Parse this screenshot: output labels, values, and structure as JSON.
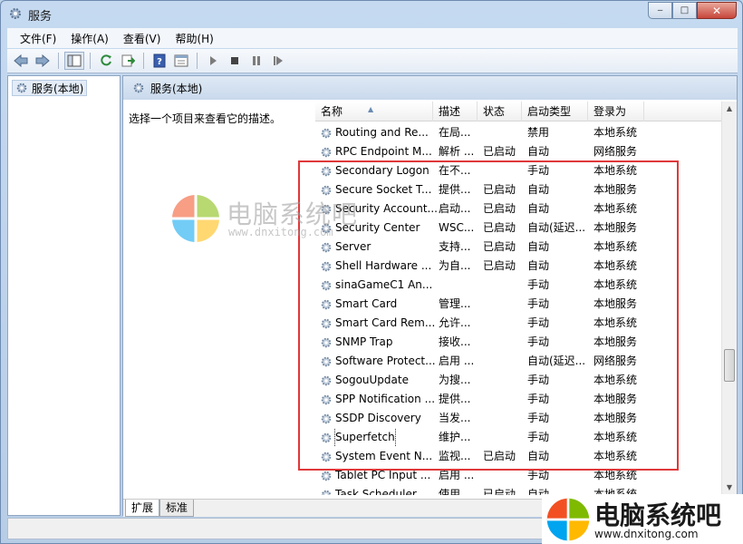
{
  "window": {
    "title": "服务",
    "controls": {
      "minimize": "‒",
      "maximize": "□",
      "close": "✕"
    }
  },
  "menu": [
    "文件(F)",
    "操作(A)",
    "查看(V)",
    "帮助(H)"
  ],
  "toolbar": {
    "icons": [
      "back-icon",
      "forward-icon",
      "show-hide-tree-icon",
      "refresh-icon",
      "export-list-icon",
      "help-icon",
      "properties-icon",
      "start-service-icon",
      "stop-service-icon",
      "pause-service-icon",
      "restart-service-icon"
    ]
  },
  "tree": {
    "item": "服务(本地)"
  },
  "pane": {
    "header": "服务(本地)",
    "description": "选择一个项目来查看它的描述。"
  },
  "columns": {
    "name": "名称",
    "desc": "描述",
    "state": "状态",
    "startup": "启动类型",
    "logon": "登录为"
  },
  "rows": [
    {
      "name": "Routing and Re...",
      "desc": "在局...",
      "state": "",
      "startup": "禁用",
      "logon": "本地系统"
    },
    {
      "name": "RPC Endpoint M...",
      "desc": "解析 ...",
      "state": "已启动",
      "startup": "自动",
      "logon": "网络服务"
    },
    {
      "name": "Secondary Logon",
      "desc": "在不...",
      "state": "",
      "startup": "手动",
      "logon": "本地系统"
    },
    {
      "name": "Secure Socket T...",
      "desc": "提供...",
      "state": "已启动",
      "startup": "自动",
      "logon": "本地服务"
    },
    {
      "name": "Security Account...",
      "desc": "启动...",
      "state": "已启动",
      "startup": "自动",
      "logon": "本地系统"
    },
    {
      "name": "Security Center",
      "desc": "WSC...",
      "state": "已启动",
      "startup": "自动(延迟...",
      "logon": "本地服务"
    },
    {
      "name": "Server",
      "desc": "支持...",
      "state": "已启动",
      "startup": "自动",
      "logon": "本地系统"
    },
    {
      "name": "Shell Hardware ...",
      "desc": "为自...",
      "state": "已启动",
      "startup": "自动",
      "logon": "本地系统"
    },
    {
      "name": "sinaGameC1 An...",
      "desc": "",
      "state": "",
      "startup": "手动",
      "logon": "本地系统"
    },
    {
      "name": "Smart Card",
      "desc": "管理...",
      "state": "",
      "startup": "手动",
      "logon": "本地服务"
    },
    {
      "name": "Smart Card Rem...",
      "desc": "允许...",
      "state": "",
      "startup": "手动",
      "logon": "本地系统"
    },
    {
      "name": "SNMP Trap",
      "desc": "接收...",
      "state": "",
      "startup": "手动",
      "logon": "本地服务"
    },
    {
      "name": "Software Protect...",
      "desc": "启用 ...",
      "state": "",
      "startup": "自动(延迟...",
      "logon": "网络服务"
    },
    {
      "name": "SogouUpdate",
      "desc": "为搜...",
      "state": "",
      "startup": "手动",
      "logon": "本地系统"
    },
    {
      "name": "SPP Notification ...",
      "desc": "提供...",
      "state": "",
      "startup": "手动",
      "logon": "本地服务"
    },
    {
      "name": "SSDP Discovery",
      "desc": "当发...",
      "state": "",
      "startup": "手动",
      "logon": "本地服务"
    },
    {
      "name": "Superfetch",
      "desc": "维护...",
      "state": "",
      "startup": "手动",
      "logon": "本地系统"
    },
    {
      "name": "System Event N...",
      "desc": "监视...",
      "state": "已启动",
      "startup": "自动",
      "logon": "本地系统"
    },
    {
      "name": "Tablet PC Input ...",
      "desc": "启用 ...",
      "state": "",
      "startup": "手动",
      "logon": "本地系统"
    },
    {
      "name": "Task Scheduler",
      "desc": "使用...",
      "state": "已启动",
      "startup": "自动",
      "logon": "本地系统"
    }
  ],
  "tabs": [
    "扩展",
    "标准"
  ],
  "watermark": {
    "center_text": "电脑系统吧",
    "center_url": "www.dnxitong.com",
    "corner_text": "电脑系统吧",
    "corner_url": "www.dnxitong.com"
  },
  "highlight_color": "#e0383a"
}
